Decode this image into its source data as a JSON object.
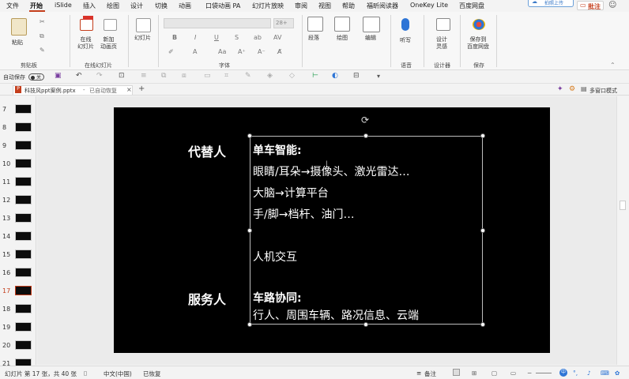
{
  "menu": {
    "items": [
      "文件",
      "开始",
      "iSlide",
      "插入",
      "绘图",
      "设计",
      "切换",
      "动画",
      "口袋动画 PA",
      "幻灯片放映",
      "审阅",
      "视图",
      "帮助",
      "福昕阅读器",
      "OneKey Lite",
      "百度网盘"
    ],
    "active": "开始",
    "upload_label": "拍照上传",
    "comment_label": "批注"
  },
  "ribbon": {
    "paste": "粘贴",
    "clipboard_group": "剪贴板",
    "online_slides": "在线\n幻灯片",
    "new_anim_page": "新加\n动画页",
    "online_group": "在线幻灯片",
    "slide_btn": "幻灯片",
    "font_name": "",
    "font_size": "28+",
    "font_group": "字体",
    "paragraph": "段落",
    "drawing": "绘图",
    "editing": "编辑",
    "dictate": "听写",
    "voice_group": "语音",
    "design_ideas": "设计\n灵感",
    "designer_group": "设计器",
    "save_baidu": "保存到\n百度网盘",
    "save_group": "保存"
  },
  "qat": {
    "autosave_label": "自动保存",
    "autosave_state": "关"
  },
  "doc_tab": {
    "name": "科技风ppt案例.pptx",
    "status": "已自动恢复",
    "multiwindow": "多窗口模式"
  },
  "thumbnails": [
    {
      "num": "7"
    },
    {
      "num": "8"
    },
    {
      "num": "9"
    },
    {
      "num": "10"
    },
    {
      "num": "11"
    },
    {
      "num": "12"
    },
    {
      "num": "13"
    },
    {
      "num": "14"
    },
    {
      "num": "15"
    },
    {
      "num": "16"
    },
    {
      "num": "17",
      "selected": true
    },
    {
      "num": "18"
    },
    {
      "num": "19"
    },
    {
      "num": "20"
    },
    {
      "num": "21"
    }
  ],
  "slide": {
    "left_label_1": "代替人",
    "left_label_2": "服务人",
    "lines": [
      "单车智能:",
      "眼睛/耳朵→摄像头、激光雷达…",
      "大脑→计算平台",
      "手/脚→档杆、油门…",
      "人机交互",
      "车路协同:",
      "行人、周围车辆、路况信息、云端"
    ]
  },
  "status": {
    "slide_info": "幻灯片 第 17 张，共 40 张",
    "language": "中文(中国)",
    "recovered": "已恢复",
    "notes": "备注",
    "ime": "中"
  }
}
